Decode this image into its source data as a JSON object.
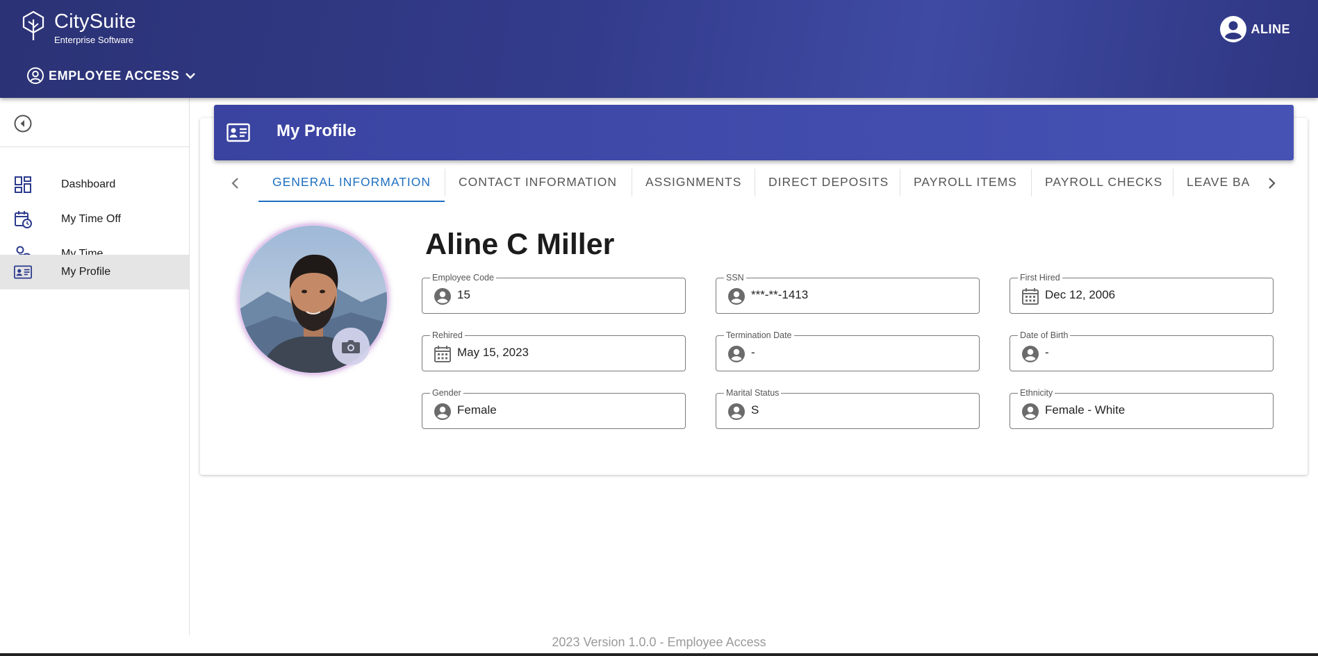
{
  "app": {
    "name": "CitySuite",
    "tagline": "Enterprise Software",
    "module": "EMPLOYEE ACCESS",
    "user": "ALINE"
  },
  "sidebar": {
    "items": [
      {
        "label": "Dashboard",
        "icon": "dashboard-icon"
      },
      {
        "label": "My Time Off",
        "icon": "calendar-clock-icon"
      },
      {
        "label": "My Time",
        "icon": "user-clock-icon"
      },
      {
        "label": "My Profile",
        "icon": "id-card-icon",
        "active": true
      }
    ]
  },
  "page": {
    "title": "My Profile",
    "tabs": [
      "GENERAL INFORMATION",
      "CONTACT INFORMATION",
      "ASSIGNMENTS",
      "DIRECT DEPOSITS",
      "PAYROLL ITEMS",
      "PAYROLL CHECKS",
      "LEAVE BA"
    ],
    "active_tab": "GENERAL INFORMATION"
  },
  "profile": {
    "full_name": "Aline C Miller",
    "fields": [
      {
        "label": "Employee Code",
        "value": "15",
        "icon": "person-icon"
      },
      {
        "label": "SSN",
        "value": "***-**-1413",
        "icon": "person-icon"
      },
      {
        "label": "First Hired",
        "value": "Dec 12, 2006",
        "icon": "calendar-icon"
      },
      {
        "label": "Rehired",
        "value": "May 15, 2023",
        "icon": "calendar-icon"
      },
      {
        "label": "Termination Date",
        "value": "-",
        "icon": "person-icon"
      },
      {
        "label": "Date of Birth",
        "value": "-",
        "icon": "person-icon"
      },
      {
        "label": "Gender",
        "value": "Female",
        "icon": "person-icon"
      },
      {
        "label": "Marital Status",
        "value": "S",
        "icon": "person-icon"
      },
      {
        "label": "Ethnicity",
        "value": "Female - White",
        "icon": "person-icon"
      }
    ]
  },
  "footer": "2023 Version 1.0.0 - Employee Access",
  "colors": {
    "appbar": "#333c8c",
    "header": "#4350b0",
    "accent": "#1e6fc0",
    "icon": "#2b3a8c"
  }
}
